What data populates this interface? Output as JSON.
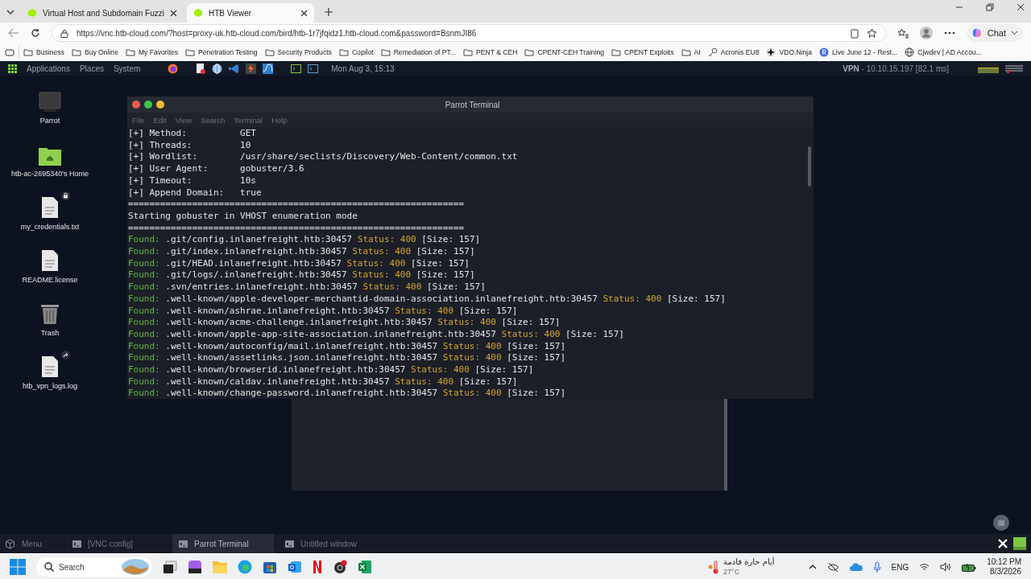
{
  "browser": {
    "tabs": [
      {
        "title": "Virtual Host and Subdomain Fuzzi",
        "selected": false
      },
      {
        "title": "HTB Viewer",
        "selected": true
      }
    ],
    "url": "https://vnc.htb-cloud.com/?host=proxy-uk.htb-cloud.com/bird/htb-1r7jfqidz1.htb-cloud.com&password=BsnmJI86",
    "chat_label": "Chat",
    "bookmarks": [
      {
        "label": "Business",
        "kind": "folder"
      },
      {
        "label": "Buy Online",
        "kind": "folder"
      },
      {
        "label": "My Favorites",
        "kind": "folder"
      },
      {
        "label": "Penetration Testing",
        "kind": "folder"
      },
      {
        "label": "Security Products",
        "kind": "folder"
      },
      {
        "label": "Copilot",
        "kind": "folder"
      },
      {
        "label": "Remediation of PT...",
        "kind": "folder"
      },
      {
        "label": "PENT & CEH",
        "kind": "folder"
      },
      {
        "label": "CPENT-CEH Training",
        "kind": "folder"
      },
      {
        "label": "CPENT Exploits",
        "kind": "folder"
      },
      {
        "label": "AI",
        "kind": "folder"
      },
      {
        "label": "Acronis EU8",
        "kind": "key"
      },
      {
        "label": "VDO.Ninja",
        "kind": "star"
      },
      {
        "label": "Live June 12 - Rest...",
        "kind": "circle"
      },
      {
        "label": "Cjwdev | AD Accou...",
        "kind": "globe"
      }
    ]
  },
  "parrot_panel": {
    "menus": [
      "Applications",
      "Places",
      "System"
    ],
    "clock": "Mon Aug 3, 15:13",
    "vpn_label": "VPN",
    "vpn_info": "- 10.10.15.197 [82.1 ms]"
  },
  "desktop_icons": [
    {
      "label": "Parrot",
      "kind": "monitor",
      "locked": false,
      "shortcut": false
    },
    {
      "label": "htb-ac-2695340's Home",
      "kind": "home-folder",
      "locked": false,
      "shortcut": false
    },
    {
      "label": "my_credentials.txt",
      "kind": "document",
      "locked": true,
      "shortcut": false
    },
    {
      "label": "README.license",
      "kind": "document",
      "locked": false,
      "shortcut": false
    },
    {
      "label": "Trash",
      "kind": "trash",
      "locked": false,
      "shortcut": false
    },
    {
      "label": "htb_vpn_logs.log",
      "kind": "document",
      "locked": false,
      "shortcut": true
    }
  ],
  "terminal": {
    "title": "Parrot Terminal",
    "menu": [
      "File",
      "Edit",
      "View",
      "Search",
      "Terminal",
      "Help"
    ],
    "settings": [
      {
        "key": "[+] Method:",
        "value": "GET"
      },
      {
        "key": "[+] Threads:",
        "value": "10"
      },
      {
        "key": "[+] Wordlist:",
        "value": "/usr/share/seclists/Discovery/Web-Content/common.txt"
      },
      {
        "key": "[+] User Agent:",
        "value": "gobuster/3.6"
      },
      {
        "key": "[+] Timeout:",
        "value": "10s"
      },
      {
        "key": "[+] Append Domain:",
        "value": "true"
      }
    ],
    "separator": "===============================================================",
    "start_line": "Starting gobuster in VHOST enumeration mode",
    "results": [
      {
        "prefix": "Found:",
        "host": ".git/config.inlanefreight.htb:30457",
        "status": "Status: 400",
        "size": "[Size: 157]"
      },
      {
        "prefix": "Found:",
        "host": ".git/index.inlanefreight.htb:30457",
        "status": "Status: 400",
        "size": "[Size: 157]"
      },
      {
        "prefix": "Found:",
        "host": ".git/HEAD.inlanefreight.htb:30457",
        "status": "Status: 400",
        "size": "[Size: 157]"
      },
      {
        "prefix": "Found:",
        "host": ".git/logs/.inlanefreight.htb:30457",
        "status": "Status: 400",
        "size": "[Size: 157]"
      },
      {
        "prefix": "Found:",
        "host": ".svn/entries.inlanefreight.htb:30457",
        "status": "Status: 400",
        "size": "[Size: 157]"
      },
      {
        "prefix": "Found:",
        "host": ".well-known/apple-developer-merchantid-domain-association.inlanefreight.htb:30457",
        "status": "Status: 400",
        "size": "[Size: 157]"
      },
      {
        "prefix": "Found:",
        "host": ".well-known/ashrae.inlanefreight.htb:30457",
        "status": "Status: 400",
        "size": "[Size: 157]"
      },
      {
        "prefix": "Found:",
        "host": ".well-known/acme-challenge.inlanefreight.htb:30457",
        "status": "Status: 400",
        "size": "[Size: 157]"
      },
      {
        "prefix": "Found:",
        "host": ".well-known/apple-app-site-association.inlanefreight.htb:30457",
        "status": "Status: 400",
        "size": "[Size: 157]"
      },
      {
        "prefix": "Found:",
        "host": ".well-known/autoconfig/mail.inlanefreight.htb:30457",
        "status": "Status: 400",
        "size": "[Size: 157]"
      },
      {
        "prefix": "Found:",
        "host": ".well-known/assetlinks.json.inlanefreight.htb:30457",
        "status": "Status: 400",
        "size": "[Size: 157]"
      },
      {
        "prefix": "Found:",
        "host": ".well-known/browserid.inlanefreight.htb:30457",
        "status": "Status: 400",
        "size": "[Size: 157]"
      },
      {
        "prefix": "Found:",
        "host": ".well-known/caldav.inlanefreight.htb:30457",
        "status": "Status: 400",
        "size": "[Size: 157]"
      },
      {
        "prefix": "Found:",
        "host": ".well-known/change-password.inlanefreight.htb:30457",
        "status": "Status: 400",
        "size": "[Size: 157]"
      }
    ]
  },
  "parrot_taskbar": {
    "menu_label": "Menu",
    "windows": [
      {
        "title": "[VNC config]",
        "selected": false
      },
      {
        "title": "Parrot Terminal",
        "selected": true
      },
      {
        "title": "Untitled window",
        "selected": false
      }
    ]
  },
  "windows_taskbar": {
    "search_placeholder": "Search",
    "weather_text": "أيام حارة قادمة",
    "temperature": "27°C",
    "language": "ENG",
    "time": "10:12 PM",
    "date": "8/3/2026"
  }
}
